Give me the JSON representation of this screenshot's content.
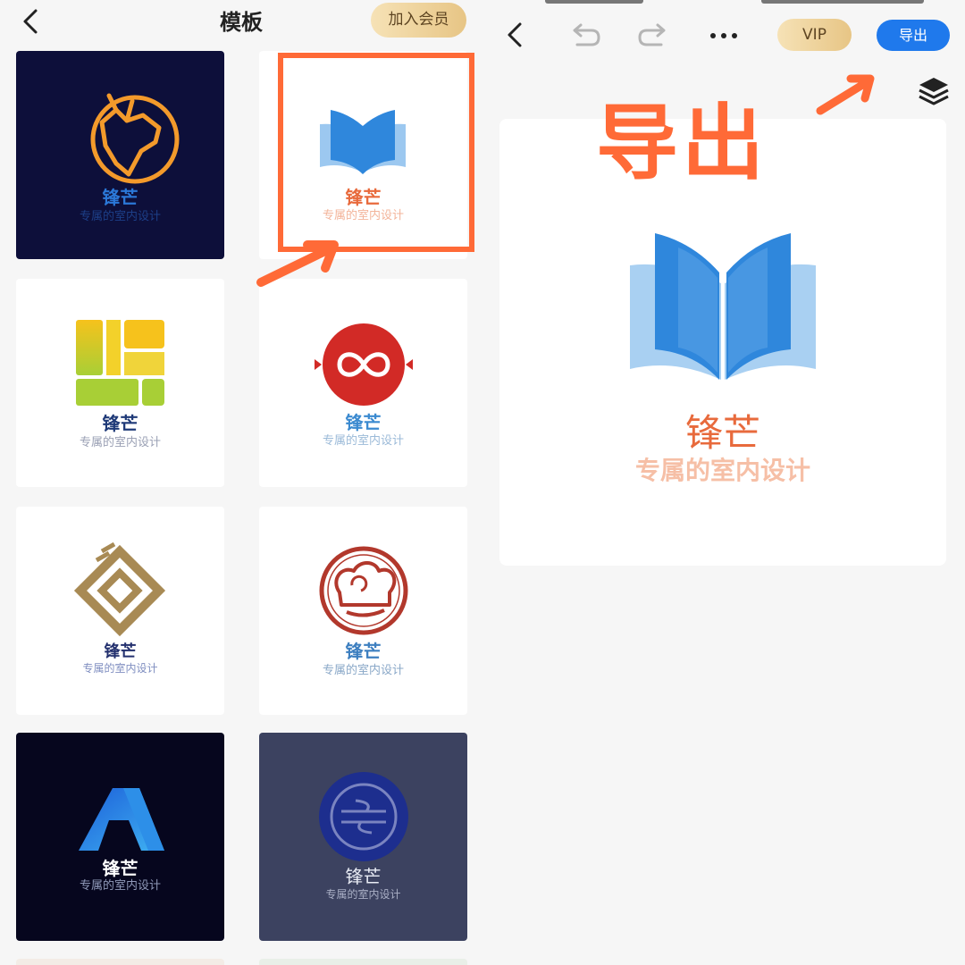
{
  "left": {
    "title": "模板",
    "member_button": "加入会员",
    "templates": [
      {
        "brand": "锋芒",
        "slogan": "专属的室内设计",
        "bg": "#0d0f3a",
        "brand_color": "#2b78d8",
        "slogan_color": "#1d3f88",
        "icon": "deer-logo-icon"
      },
      {
        "brand": "锋芒",
        "slogan": "专属的室内设计",
        "bg": "#ffffff",
        "brand_color": "#e86a3c",
        "slogan_color": "#f3b49a",
        "icon": "open-book-logo-icon"
      },
      {
        "brand": "锋芒",
        "slogan": "专属的室内设计",
        "bg": "#ffffff",
        "brand_color": "#1f3a78",
        "slogan_color": "#9aa0b4",
        "icon": "yellow-green-blocks-logo-icon"
      },
      {
        "brand": "锋芒",
        "slogan": "专属的室内设计",
        "bg": "#ffffff",
        "brand_color": "#3b8ad0",
        "slogan_color": "#9bbad8",
        "icon": "red-infinity-logo-icon"
      },
      {
        "brand": "锋芒",
        "slogan": "专属的室内设计",
        "bg": "#ffffff",
        "brand_color": "#23306e",
        "slogan_color": "#7f8ec0",
        "icon": "golden-diamond-logo-icon"
      },
      {
        "brand": "锋芒",
        "slogan": "专属的室内设计",
        "bg": "#ffffff",
        "brand_color": "#3d7fc0",
        "slogan_color": "#8aa8c8",
        "icon": "chef-hat-logo-icon"
      },
      {
        "brand": "锋芒",
        "slogan": "专属的室内设计",
        "bg": "#06061e",
        "brand_color": "#ffffff",
        "slogan_color": "#8f99b8",
        "icon": "blue-letter-a-logo-icon"
      },
      {
        "brand": "锋芒",
        "slogan": "专属的室内设计",
        "bg": "#3c4260",
        "brand_color": "#e9ecf5",
        "slogan_color": "#aab0c6",
        "icon": "navy-circle-logo-icon"
      }
    ]
  },
  "right": {
    "vip_button": "VIP",
    "export_button": "导出",
    "annotation": "导出",
    "canvas": {
      "brand": "锋芒",
      "slogan": "专属的室内设计",
      "brand_color": "#e86a3c",
      "slogan_color": "#f6bfa6",
      "icon": "open-book-logo-icon"
    }
  },
  "colors": {
    "accent_blue": "#1f79ec",
    "annotation_orange": "#ff6a37",
    "vip_gold": "#e7c585"
  }
}
